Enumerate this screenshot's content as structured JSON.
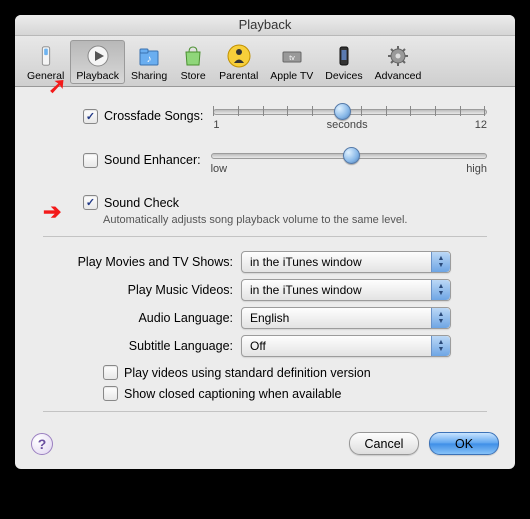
{
  "window": {
    "title": "Playback"
  },
  "toolbar": {
    "items": [
      {
        "label": "General"
      },
      {
        "label": "Playback"
      },
      {
        "label": "Sharing"
      },
      {
        "label": "Store"
      },
      {
        "label": "Parental"
      },
      {
        "label": "Apple TV"
      },
      {
        "label": "Devices"
      },
      {
        "label": "Advanced"
      }
    ]
  },
  "options": {
    "crossfade": {
      "label": "Crossfade Songs:",
      "checked": true,
      "min_label": "1",
      "unit_label": "seconds",
      "max_label": "12",
      "value_pos_pct": 44
    },
    "enhancer": {
      "label": "Sound Enhancer:",
      "checked": false,
      "low_label": "low",
      "high_label": "high",
      "value_pos_pct": 50
    },
    "soundcheck": {
      "label": "Sound Check",
      "checked": true,
      "description": "Automatically adjusts song playback volume to the same level."
    }
  },
  "dropdowns": {
    "movies": {
      "label": "Play Movies and TV Shows:",
      "value": "in the iTunes window"
    },
    "music_videos": {
      "label": "Play Music Videos:",
      "value": "in the iTunes window"
    },
    "audio_lang": {
      "label": "Audio Language:",
      "value": "English"
    },
    "subtitle_lang": {
      "label": "Subtitle Language:",
      "value": "Off"
    }
  },
  "video_opts": {
    "sd": {
      "label": "Play videos using standard definition version",
      "checked": false
    },
    "cc": {
      "label": "Show closed captioning when available",
      "checked": false
    }
  },
  "buttons": {
    "cancel": "Cancel",
    "ok": "OK"
  }
}
